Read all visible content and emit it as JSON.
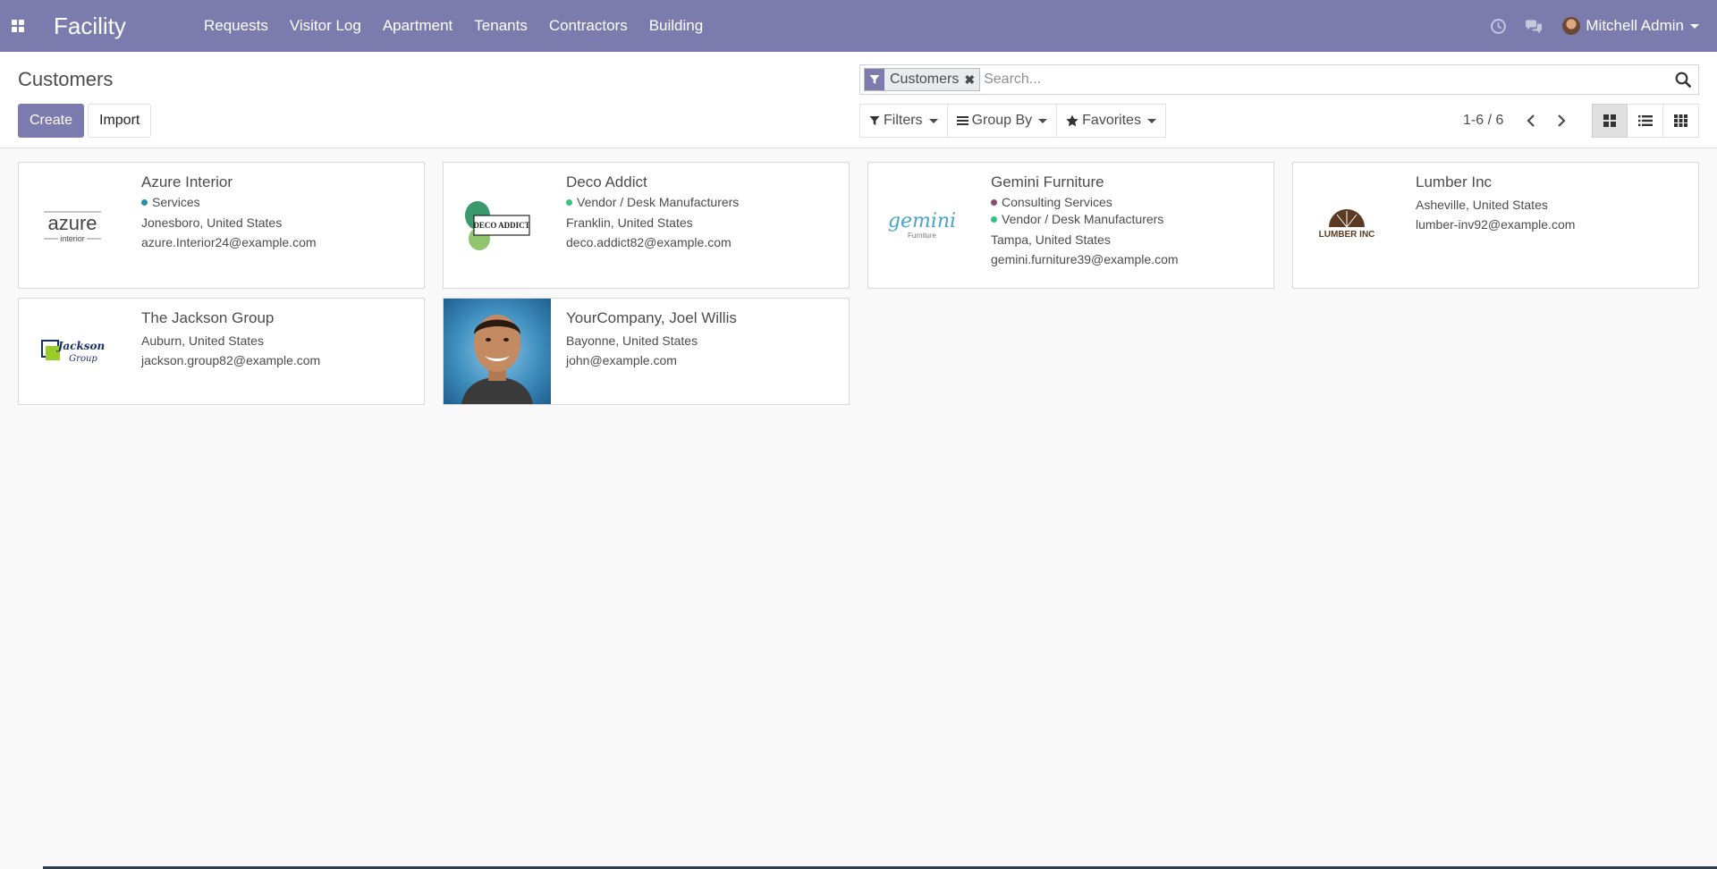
{
  "navbar": {
    "brand": "Facility",
    "menu": [
      "Requests",
      "Visitor Log",
      "Apartment",
      "Tenants",
      "Contractors",
      "Building"
    ],
    "user_name": "Mitchell Admin",
    "icons": [
      "apps-icon",
      "clock-icon",
      "chat-icon"
    ],
    "bg_color": "#7c7bad"
  },
  "control_panel": {
    "title": "Customers",
    "create_label": "Create",
    "import_label": "Import",
    "search": {
      "facet_label": "Customers",
      "placeholder": "Search..."
    },
    "filters_label": "Filters",
    "group_by_label": "Group By",
    "favorites_label": "Favorites",
    "pager": "1-6 / 6",
    "active_view": "kanban"
  },
  "cards": [
    {
      "name": "Azure Interior",
      "logo": "azure interior logo",
      "tags": [
        {
          "label": "Services",
          "color": "#2a8cab"
        }
      ],
      "location": "Jonesboro, United States",
      "email": "azure.Interior24@example.com"
    },
    {
      "name": "Deco Addict",
      "logo": "deco addict logo",
      "tags": [
        {
          "label": "Vendor / Desk Manufacturers",
          "color": "#30c381"
        }
      ],
      "location": "Franklin, United States",
      "email": "deco.addict82@example.com"
    },
    {
      "name": "Gemini Furniture",
      "logo": "gemini furniture logo",
      "tags": [
        {
          "label": "Consulting Services",
          "color": "#8a4a6a"
        },
        {
          "label": "Vendor / Desk Manufacturers",
          "color": "#30c381"
        }
      ],
      "location": "Tampa, United States",
      "email": "gemini.furniture39@example.com"
    },
    {
      "name": "Lumber Inc",
      "logo": "lumber inc logo",
      "tags": [],
      "location": "Asheville, United States",
      "email": "lumber-inv92@example.com"
    },
    {
      "name": "The Jackson Group",
      "logo": "jackson group logo",
      "tags": [],
      "location": "Auburn, United States",
      "email": "jackson.group82@example.com"
    },
    {
      "name": "YourCompany, Joel Willis",
      "logo": "person photo",
      "tags": [],
      "location": "Bayonne, United States",
      "email": "john@example.com"
    }
  ],
  "logo_text": {
    "azure_main": "azure",
    "azure_sub": "interior",
    "deco": "DECO ADDICT",
    "gemini_main": "gemini",
    "gemini_sub": "Furniture",
    "lumber": "LUMBER INC",
    "jackson_main": "Jackson",
    "jackson_sub": "Group"
  }
}
